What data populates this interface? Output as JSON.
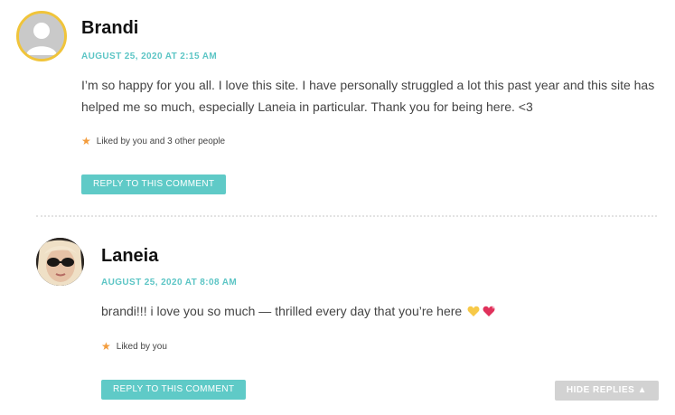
{
  "comments": [
    {
      "author": "Brandi",
      "date": "AUGUST 25, 2020 AT 2:15 AM",
      "text": "I’m so happy for you all. I love this site. I have personally struggled a lot this past year and this site has helped me so much, especially Laneia in particular. Thank you for being here. <3",
      "likes": "Liked by you and 3 other people",
      "reply_label": "REPLY TO THIS COMMENT",
      "avatar_icon": "default-user-avatar",
      "avatar_ring_color": "#f0c43a"
    },
    {
      "author": "Laneia",
      "date": "AUGUST 25, 2020 AT 8:08 AM",
      "text": "brandi!!! i love you so much — thrilled every day that you’re here",
      "emoji": [
        "yellow-heart",
        "sparkling-heart"
      ],
      "likes": "Liked by you",
      "reply_label": "REPLY TO THIS COMMENT",
      "avatar_icon": "photo-avatar-sunglasses"
    }
  ],
  "hide_replies": {
    "label": "HIDE REPLIES",
    "icon": "caret-up-icon"
  },
  "colors": {
    "accent": "#5fcac7",
    "date": "#5cc5c5",
    "star": "#f39c3c",
    "hide_button": "#d2d2d2"
  }
}
